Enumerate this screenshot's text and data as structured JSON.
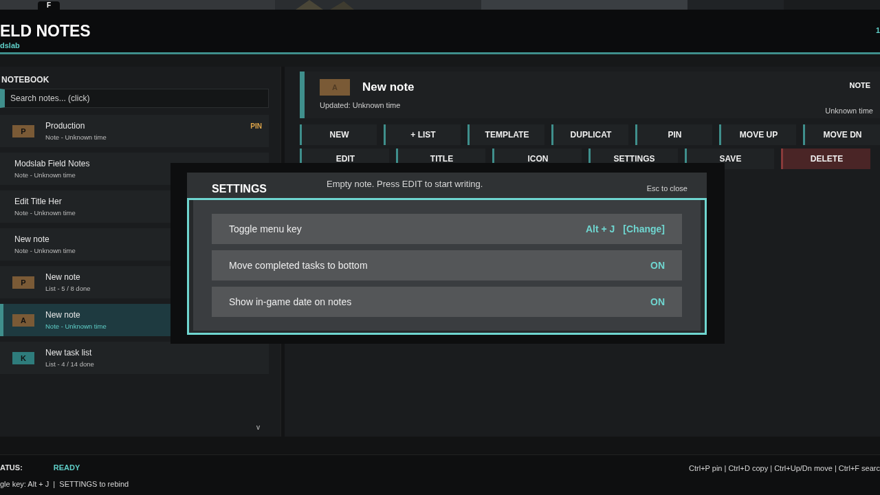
{
  "top_tab": {
    "label": "F"
  },
  "header": {
    "title": "ELD NOTES",
    "subtitle": "dslab",
    "corner": "1"
  },
  "sidebar": {
    "title": "NOTEBOOK",
    "search": {
      "placeholder": "Search notes... (click)"
    },
    "items": [
      {
        "title": "Production",
        "meta": "Note - Unknown time",
        "icon_letter": "P",
        "color": "#7a5a36",
        "pin": "PIN",
        "selected": false
      },
      {
        "title": "Modslab Field Notes",
        "meta": "Note - Unknown time",
        "selected": false
      },
      {
        "title": "Edit Title Her",
        "meta": "Note - Unknown time",
        "selected": false
      },
      {
        "title": "New note",
        "meta": "Note - Unknown time",
        "selected": false
      },
      {
        "title": "New note",
        "meta": "List - 5 / 8 done",
        "icon_letter": "P",
        "color": "#7a5a36",
        "selected": false
      },
      {
        "title": "New note",
        "meta": "Note - Unknown time",
        "icon_letter": "A",
        "color": "#7a5a36",
        "selected": true
      },
      {
        "title": "New task list",
        "meta": "List - 4 / 14 done",
        "icon_letter": "K",
        "color": "#2e7c7c",
        "selected": false
      }
    ],
    "scroll_indicator": "v"
  },
  "note": {
    "icon_letter": "A",
    "title": "New note",
    "type": "NOTE",
    "updated": "Updated: Unknown time",
    "time": "Unknown time",
    "body": "Empty note. Press EDIT to start writing."
  },
  "toolbar": {
    "rows": [
      [
        {
          "label": "NEW",
          "kind": "normal"
        },
        {
          "label": "+ LIST",
          "kind": "normal"
        },
        {
          "label": "TEMPLATE",
          "kind": "normal"
        },
        {
          "label": "DUPLICAT",
          "kind": "normal"
        },
        {
          "label": "PIN",
          "kind": "normal"
        },
        {
          "label": "MOVE UP",
          "kind": "normal"
        },
        {
          "label": "MOVE DN",
          "kind": "normal"
        }
      ],
      [
        {
          "label": "EDIT",
          "kind": "normal"
        },
        {
          "label": "TITLE",
          "kind": "normal"
        },
        {
          "label": "ICON",
          "kind": "normal"
        },
        {
          "label": "SETTINGS",
          "kind": "normal"
        },
        {
          "label": "SAVE",
          "kind": "normal"
        },
        {
          "label": "DELETE",
          "kind": "danger"
        }
      ]
    ]
  },
  "settings_dialog": {
    "title": "SETTINGS",
    "hint": "Esc to close",
    "rows": [
      {
        "kind": "keybind",
        "label": "Toggle menu key",
        "value": "Alt + J",
        "action": "[Change]"
      },
      {
        "kind": "toggle",
        "label": "Move completed tasks to bottom",
        "on": true,
        "value": "ON"
      },
      {
        "kind": "toggle",
        "label": "Show in-game date on notes",
        "on": true,
        "value": "ON"
      }
    ]
  },
  "status_bar": {
    "label": "ATUS:",
    "status": "READY",
    "hint": "gle key: Alt + J  |  SETTINGS to rebind",
    "shortcuts": "Ctrl+P pin | Ctrl+D copy | Ctrl+Up/Dn move | Ctrl+F searc"
  }
}
